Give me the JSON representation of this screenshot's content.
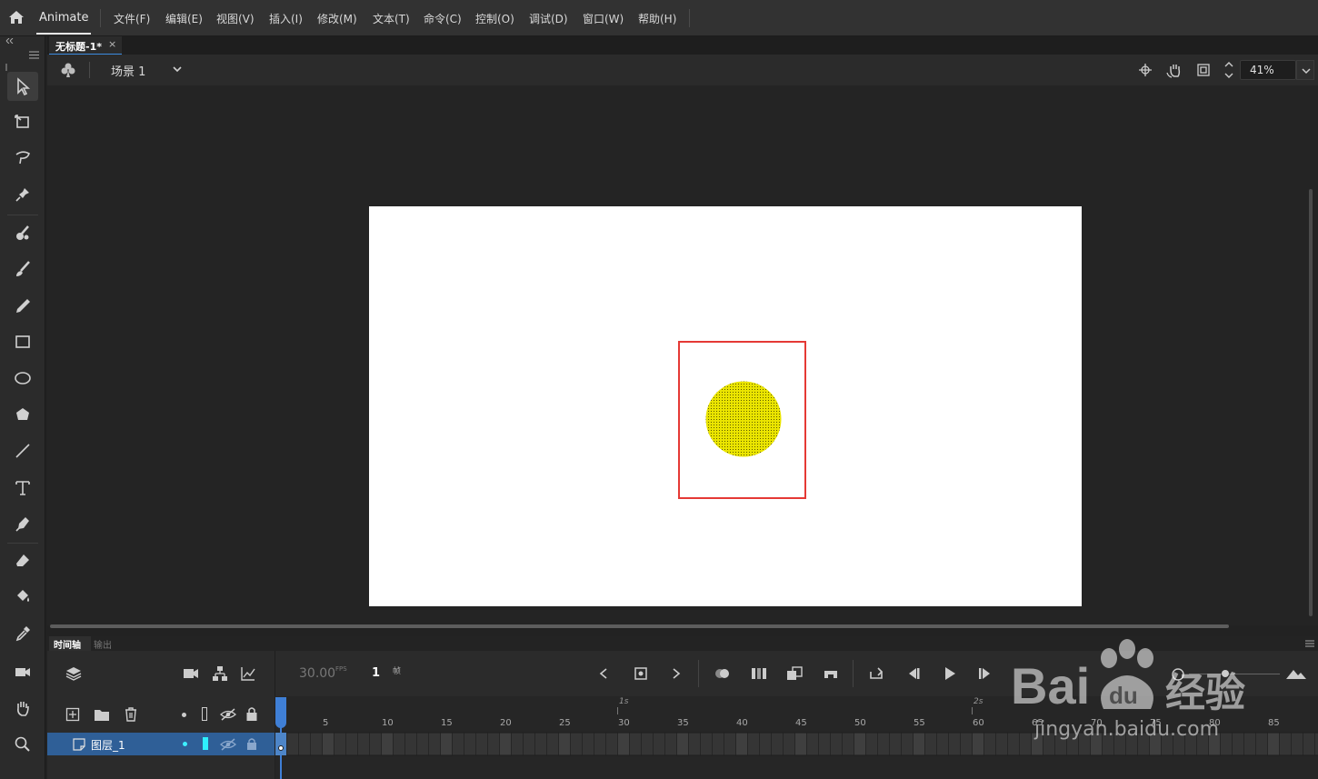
{
  "app": {
    "name": "Animate"
  },
  "menu": [
    "文件(F)",
    "编辑(E)",
    "视图(V)",
    "插入(I)",
    "修改(M)",
    "文本(T)",
    "命令(C)",
    "控制(O)",
    "调试(D)",
    "窗口(W)",
    "帮助(H)"
  ],
  "document": {
    "tab_title": "无标题-1*",
    "close": "×"
  },
  "scene": {
    "label": "场景 1"
  },
  "zoom": {
    "value": "41%"
  },
  "timeline": {
    "tab_timeline": "时间轴",
    "tab_output": "输出",
    "fps": "30.00",
    "fps_unit": "FPS",
    "frame": "1",
    "frame_unit": "帧",
    "ruler_1s": "1s",
    "ruler_2s": "2s",
    "ruler_numbers": [
      "5",
      "10",
      "15",
      "20",
      "25",
      "30",
      "35",
      "40",
      "45",
      "50",
      "55",
      "60",
      "65",
      "70",
      "75",
      "80",
      "85"
    ],
    "layer_name": "图层_1"
  },
  "stage": {
    "shape": "circle",
    "fill_color": "#e8e400",
    "highlight_color": "#e53935"
  },
  "watermark": {
    "brand": "Bai",
    "brand2": "du",
    "brand_cn": "经验",
    "url": "jingyan.baidu.com"
  },
  "colors": {
    "accent": "#3c8be0",
    "layer_selected": "#2f5f97",
    "playhead": "#3f7fd6"
  }
}
